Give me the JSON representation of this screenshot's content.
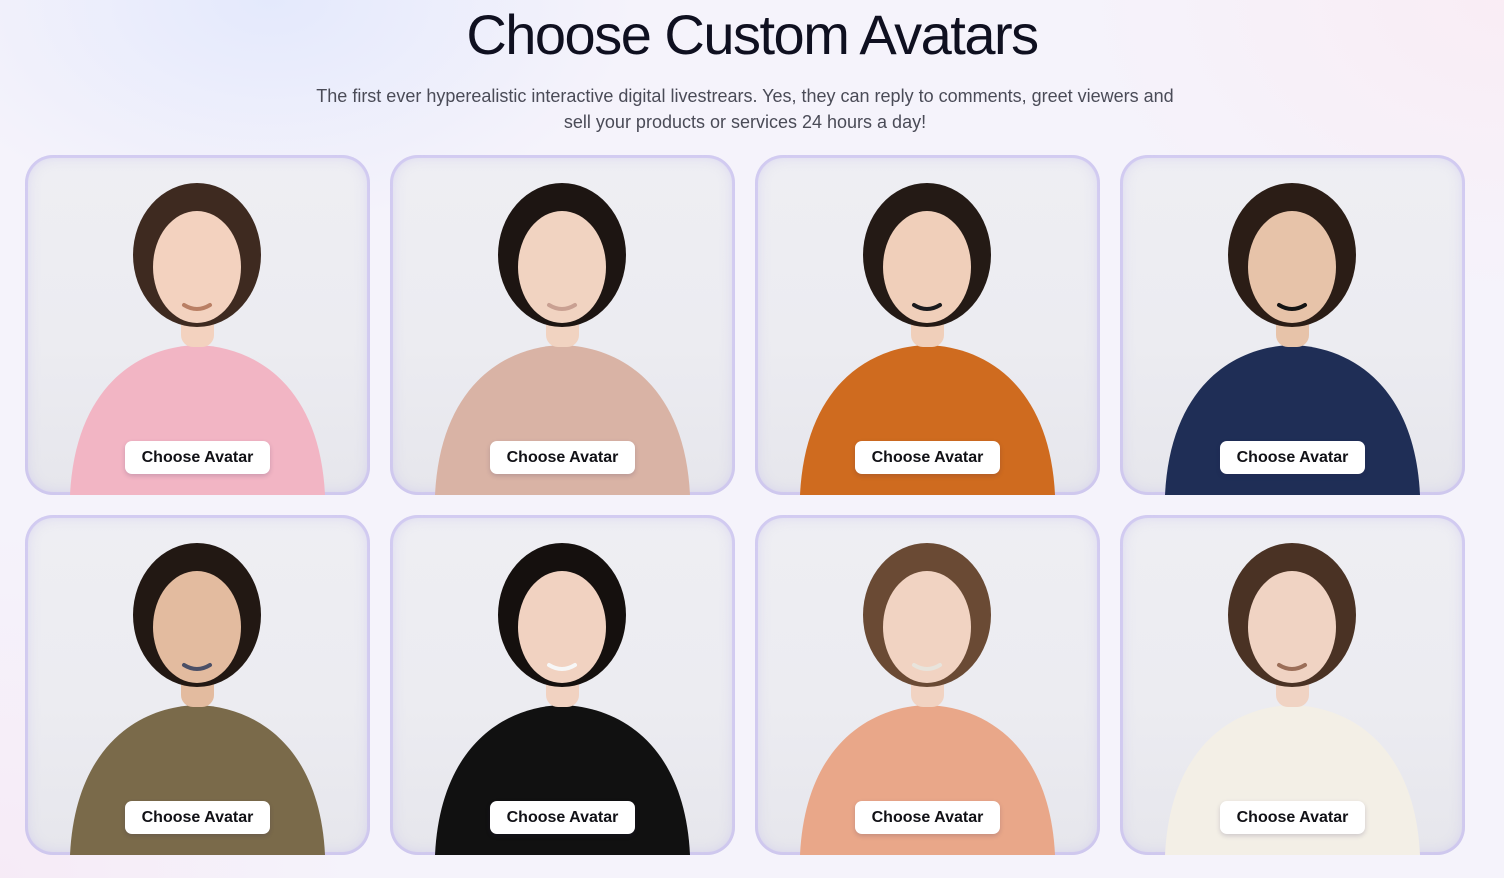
{
  "header": {
    "title": "Choose Custom Avatars",
    "subtitle": "The first ever hyperealistic interactive digital livestrears. Yes, they can reply to comments, greet viewers and sell your products or services 24 hours a day!"
  },
  "avatars": [
    {
      "button_label": "Choose Avatar",
      "skin": "#f3d2bf",
      "hair": "#3e2a20",
      "outfit": "#f2b5c4",
      "accent": "#b97f64"
    },
    {
      "button_label": "Choose Avatar",
      "skin": "#f1d3c1",
      "hair": "#1d1512",
      "outfit": "#d9b3a5",
      "accent": "#c9a092"
    },
    {
      "button_label": "Choose Avatar",
      "skin": "#f0cfba",
      "hair": "#241a15",
      "outfit": "#cf6b1f",
      "accent": "#1b1b1e"
    },
    {
      "button_label": "Choose Avatar",
      "skin": "#e7c3a9",
      "hair": "#2b1d16",
      "outfit": "#1f2e56",
      "accent": "#141414"
    },
    {
      "button_label": "Choose Avatar",
      "skin": "#e3bb9f",
      "hair": "#221813",
      "outfit": "#7a6a4a",
      "accent": "#4b4f66"
    },
    {
      "button_label": "Choose Avatar",
      "skin": "#f1d2c1",
      "hair": "#15100e",
      "outfit": "#111111",
      "accent": "#f7f7f7"
    },
    {
      "button_label": "Choose Avatar",
      "skin": "#f1d3c2",
      "hair": "#6a4a34",
      "outfit": "#e9a789",
      "accent": "#e8e4dc"
    },
    {
      "button_label": "Choose Avatar",
      "skin": "#f0d3c3",
      "hair": "#4a3224",
      "outfit": "#f3efe6",
      "accent": "#9b6e58"
    }
  ]
}
